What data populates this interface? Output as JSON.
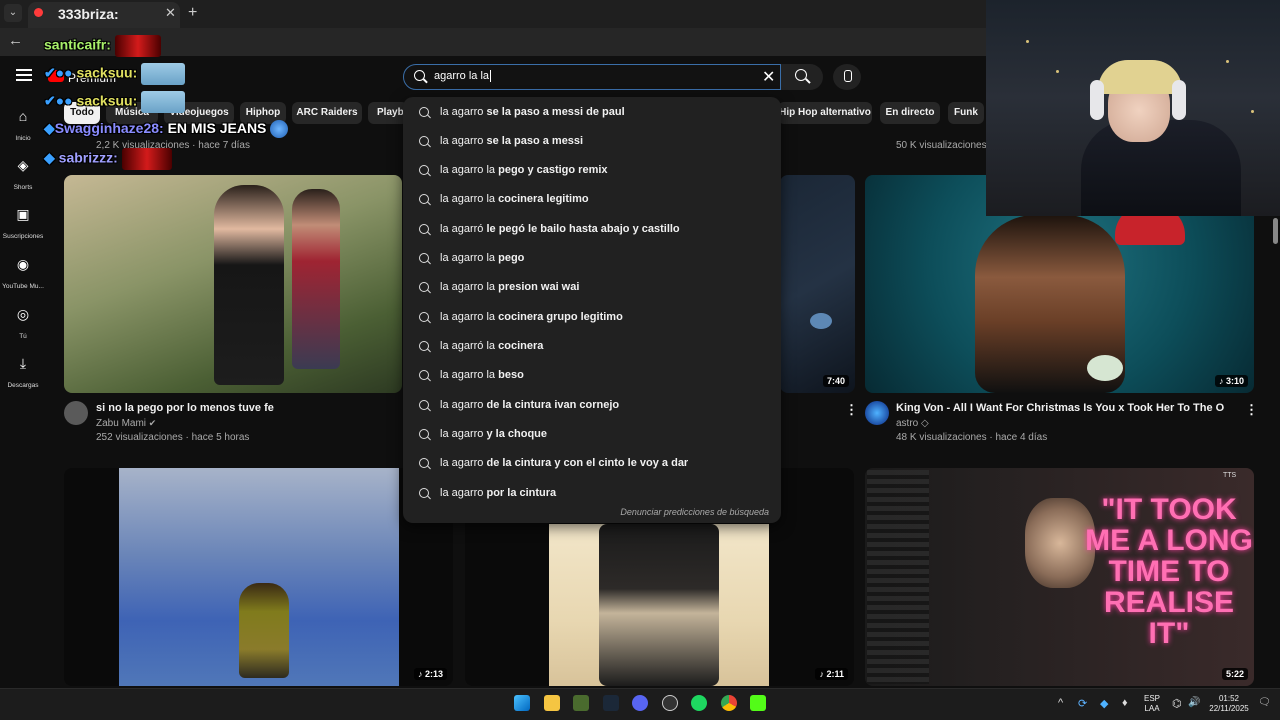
{
  "browser": {
    "tab_title": "333briza:",
    "new_tab_glyph": "+",
    "close_glyph": "✕",
    "back_glyph": "←",
    "menu_glyph": "⌄"
  },
  "youtube": {
    "logo_text": "Premium",
    "search": {
      "query": "agarro la la",
      "clear_glyph": "✕"
    },
    "chips": [
      "Todo",
      "Música",
      "Videojuegos",
      "Hiphop",
      "ARC Raiders",
      "Playb",
      "Hip Hop alternativo",
      "En directo",
      "Funk"
    ],
    "sidebar": [
      {
        "label": "Inicio",
        "icon": "home-icon",
        "glyph": "⌂"
      },
      {
        "label": "Shorts",
        "icon": "shorts-icon",
        "glyph": "◈"
      },
      {
        "label": "Suscripciones",
        "icon": "subscriptions-icon",
        "glyph": "▣"
      },
      {
        "label": "YouTube Mu...",
        "icon": "youtube-music-icon",
        "glyph": "◉"
      },
      {
        "label": "Tú",
        "icon": "you-icon",
        "glyph": "◎"
      },
      {
        "label": "Descargas",
        "icon": "downloads-icon",
        "glyph": "⤓"
      }
    ],
    "top_row_meta": {
      "left": "2,2 K visualizaciones · hace 7 días",
      "right": "50 K visualizaciones"
    },
    "videos": [
      {
        "title": "si no la pego por lo menos tuve fe",
        "channel": "Zabu Mami",
        "meta": "252 visualizaciones · hace 5 horas",
        "duration": ""
      },
      {
        "title": "",
        "channel": "",
        "meta": "",
        "duration": "7:40"
      },
      {
        "title": "King Von - All I Want For Christmas Is You x Took Her To The O",
        "channel": "astro ◇",
        "meta": "48 K visualizaciones · hace 4 días",
        "duration": "3:10"
      },
      {
        "duration": "2:13"
      },
      {
        "duration": "2:11"
      },
      {
        "duration": "5:22"
      }
    ],
    "overlay_caption": "\"IT TOOK ME A LONG TIME TO REALISE IT\"",
    "overlay_tts": "TTS",
    "kebab_glyph": "⋮",
    "music_glyph": "♪",
    "suggestions": {
      "prefix_typed": "la",
      "items": [
        {
          "pre": "la ",
          "rest": "agarro se la paso a messi de paul",
          "pre_word": "agarro",
          "bold": "se la paso a messi de paul"
        },
        {
          "pre_word": "la agarro",
          "bold": "se la paso a messi"
        },
        {
          "pre_word": "la agarro la",
          "bold": "pego y castigo remix"
        },
        {
          "pre_word": "la agarro la",
          "bold": "cocinera legitimo"
        },
        {
          "pre_word": "la agarró",
          "bold": "le pegó le bailo hasta abajo y castillo"
        },
        {
          "pre_word": "la agarro la",
          "bold": "pego"
        },
        {
          "pre_word": "la agarro la",
          "bold": "presion wai wai"
        },
        {
          "pre_word": "la agarro la",
          "bold": "cocinera grupo legitimo"
        },
        {
          "pre_word": "la agarró la",
          "bold": "cocinera"
        },
        {
          "pre_word": "la agarro la",
          "bold": "beso"
        },
        {
          "pre_word": "la agarro",
          "bold": "de la cintura ivan cornejo"
        },
        {
          "pre_word": "la agarro",
          "bold": "y la choque"
        },
        {
          "pre_word": "la agarro",
          "bold": "de la cintura y con el cinto le voy a dar"
        },
        {
          "pre_word": "la agarro",
          "bold": "por la cintura"
        }
      ],
      "report_label": "Denunciar predicciones de búsqueda"
    }
  },
  "chat_overlay": [
    {
      "user": "santicaifr:",
      "color": "#a8f06a"
    },
    {
      "user": "sacksuu:",
      "color": "#e0e060"
    },
    {
      "user": "sacksuu:",
      "color": "#e0e060"
    },
    {
      "user": "Swagginhaze28:",
      "message": " EN MIS JEANS",
      "color": "#8a8cff",
      "msg_color": "#ffffff"
    },
    {
      "user": "sabrizzz:",
      "color": "#a0a0ff"
    }
  ],
  "taskbar": {
    "language": "ESP",
    "layout": "LAA",
    "time": "01:52",
    "date": "22/11/2025",
    "tray_glyphs": {
      "overflow": "^",
      "volume": "🔊",
      "wifi": "⌬",
      "notifications": "🗨"
    }
  }
}
